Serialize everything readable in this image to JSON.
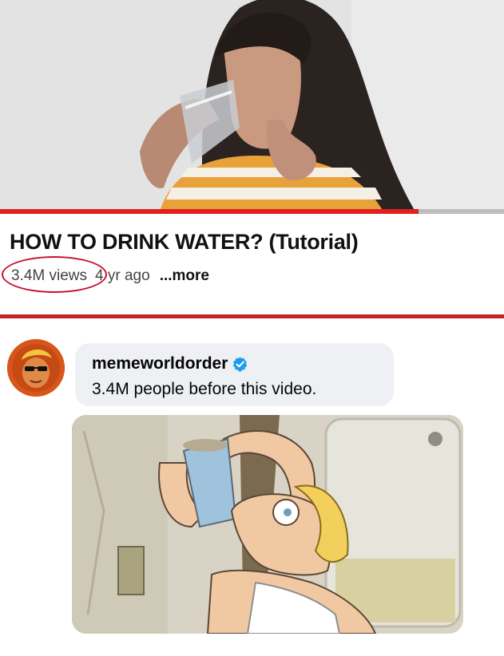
{
  "video": {
    "title": "HOW TO DRINK WATER? (Tutorial)",
    "views": "3.4M views",
    "age": "4 yr ago",
    "more": "...more",
    "progress": 0.83,
    "thumbnail": "girl-drinking-water-from-glass"
  },
  "comment": {
    "username": "memeworldorder",
    "verified": true,
    "text": "3.4M people before this video.",
    "image": "cartoon-drinking-water-from-cup"
  },
  "colors": {
    "accent_red": "#c42424",
    "progress_red": "#e0211f",
    "annotation_circle": "#c8102e",
    "verified_blue": "#1d9bf0",
    "bubble_bg": "#eef0f3"
  }
}
